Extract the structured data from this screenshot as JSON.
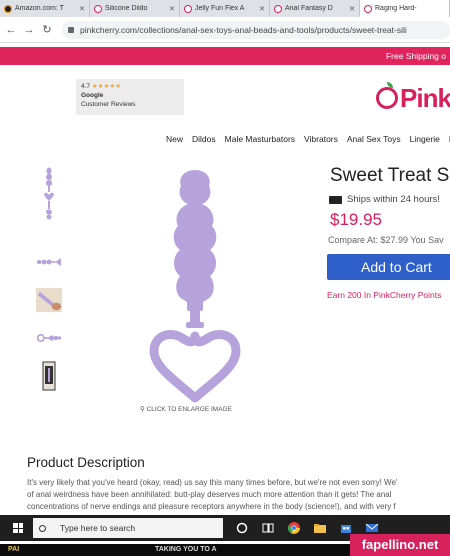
{
  "tabs": [
    {
      "title": "Amazon.com: T",
      "favicon": "amazon-icon",
      "active": false
    },
    {
      "title": "Silicone Dildo",
      "favicon": "pinkcherry-icon",
      "active": false
    },
    {
      "title": "Jelly Fun Flex A",
      "favicon": "pinkcherry-icon",
      "active": false
    },
    {
      "title": "Anal Fantasy D",
      "favicon": "pinkcherry-icon",
      "active": false
    },
    {
      "title": "Raging Hard-",
      "favicon": "pinkcherry-icon",
      "active": true
    }
  ],
  "address_bar": {
    "url": "pinkcherry.com/collections/anal-sex-toys-anal-beads-and-tools/products/sweet-treat-sili"
  },
  "promo_bar": "Free Shipping o",
  "reviews_badge": {
    "rating": "4.7",
    "stars": "★★★★★",
    "brand": "Google",
    "label": "Customer Reviews"
  },
  "logo": {
    "text": "Pink"
  },
  "nav": [
    "New",
    "Dildos",
    "Male Masturbators",
    "Vibrators",
    "Anal Sex Toys",
    "Lingerie",
    "E"
  ],
  "gallery": {
    "enlarge_label": "CLICK TO ENLARGE IMAGE",
    "product_color": "#b7a3dc"
  },
  "product": {
    "title": "Sweet Treat Silic",
    "shipping": "Ships within 24 hours!",
    "price": "$19.95",
    "compare": "Compare At: $27.99 You Sav",
    "add_to_cart": "Add to Cart",
    "rewards": "Earn 200 In PinkCherry Points"
  },
  "description": {
    "heading": "Product Description",
    "lines": [
      "It's very likely that you've heard (okay, read) us say this many times before, but we're not even sorry! We'",
      "of anal weirdness have been annihilated: butt-play deserves much more attention than it gets!  The anal",
      "concentrations of nerve endings and pleasure receptors anywhere in the body (science!), and with very f"
    ]
  },
  "taskbar": {
    "search_placeholder": "Type here to search"
  },
  "below_screen": {
    "left_text": "PAI",
    "mid_text": "TAKING YOU TO A"
  },
  "watermark": "fapellino.net",
  "colors": {
    "brand_pink": "#d6215d",
    "cart_blue": "#2f5fc9"
  }
}
